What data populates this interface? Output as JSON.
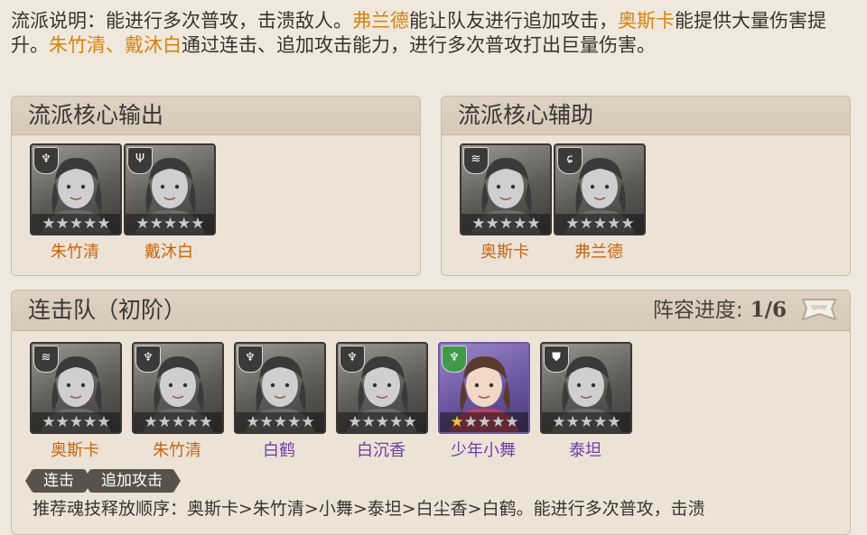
{
  "description": {
    "prefix": "流派说明：能进行多次普攻，击溃敌人。",
    "hl1": "弗兰德",
    "mid1": "能让队友进行追加攻击，",
    "hl2": "奥斯卡",
    "mid2": "能提供大量伤害提升。",
    "hl3": "朱竹清、戴沐白",
    "suffix": "通过连击、追加攻击能力，进行多次普攻打出巨量伤害。"
  },
  "core_output": {
    "title": "流派核心输出",
    "heroes": [
      {
        "name": "朱竹清",
        "badge": "wind-icon",
        "stars_lit": 0
      },
      {
        "name": "戴沐白",
        "badge": "claw-icon",
        "stars_lit": 0
      }
    ]
  },
  "core_support": {
    "title": "流派核心辅助",
    "heroes": [
      {
        "name": "奥斯卡",
        "badge": "wave-icon",
        "stars_lit": 0
      },
      {
        "name": "弗兰德",
        "badge": "swirl-icon",
        "stars_lit": 0
      }
    ]
  },
  "team": {
    "title": "连击队（初阶）",
    "progress_label": "阵容进度:",
    "progress_value": "1/6",
    "heroes": [
      {
        "name": "奥斯卡",
        "badge": "wave-icon",
        "stars_lit": 0,
        "name_color": "#c9650f"
      },
      {
        "name": "朱竹清",
        "badge": "wind-icon",
        "stars_lit": 0,
        "name_color": "#c9650f"
      },
      {
        "name": "白鹤",
        "badge": "wind-icon",
        "stars_lit": 0,
        "name_color": "#6a3fa8"
      },
      {
        "name": "白沉香",
        "badge": "wind-icon",
        "stars_lit": 0,
        "name_color": "#6a3fa8"
      },
      {
        "name": "少年小舞",
        "badge": "wind-icon",
        "stars_lit": 1,
        "name_color": "#6a3fa8"
      },
      {
        "name": "泰坦",
        "badge": "shield-icon",
        "stars_lit": 0,
        "name_color": "#6a3fa8"
      }
    ],
    "tags": [
      "连击",
      "追加攻击"
    ],
    "skill_order": "推荐魂技释放顺序：奥斯卡>朱竹清>小舞>泰坦>白尘香>白鹤。能进行多次普攻，击溃"
  },
  "colors": {
    "highlight": "#d8830d",
    "legendary_name": "#c9650f",
    "epic_name": "#6a3fa8",
    "star_on": "#f2c233"
  }
}
